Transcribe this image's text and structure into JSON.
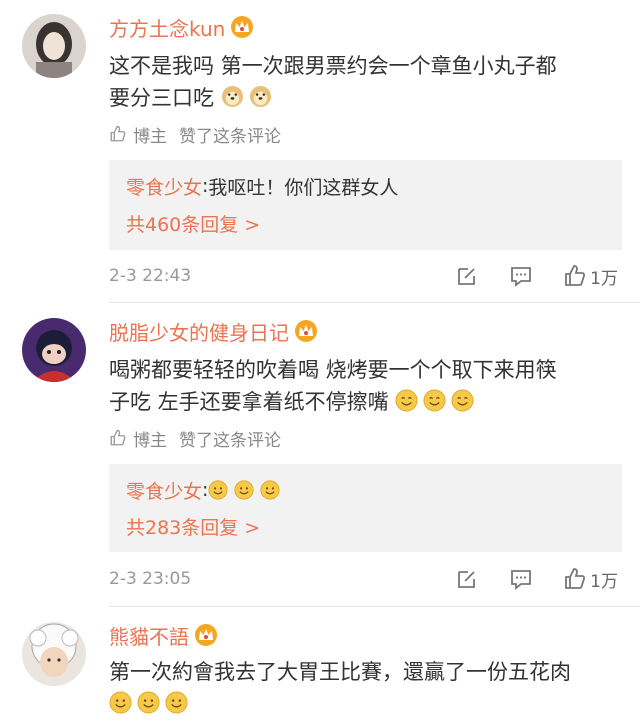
{
  "colors": {
    "username": "#eb7350",
    "reply_box": "#f2f2f2",
    "crown": "#f5a623"
  },
  "comments": [
    {
      "username": "方方土念kun",
      "text_lines": [
        "这不是我吗 第一次跟男票约会一个章鱼小丸子都",
        "要分三口吃"
      ],
      "text_emoji": [
        "doge-emoji",
        "doge-emoji"
      ],
      "like_label": "博主",
      "like_suffix": "赞了这条评论",
      "reply": {
        "name": "零食少女",
        "colon": ": ",
        "text": "我呕吐！你们这群女人",
        "count": "共460条回复 >"
      },
      "date": "2-3 22:43",
      "likes": "1万"
    },
    {
      "username": "脱脂少女的健身日记",
      "text_lines": [
        "喝粥都要轻轻的吹着喝 烧烤要一个个取下来用筷",
        "子吃 左手还要拿着纸不停擦嘴"
      ],
      "text_emoji": [
        "smile-emoji",
        "smile-emoji",
        "smile-emoji"
      ],
      "like_label": "博主",
      "like_suffix": "赞了这条评论",
      "reply": {
        "name": "零食少女",
        "colon": ": ",
        "text": "",
        "count": "共283条回复 >"
      },
      "reply_emoji": [
        "smile-emoji",
        "smile-emoji",
        "smile-emoji"
      ],
      "date": "2-3 23:05",
      "likes": "1万"
    },
    {
      "username": "熊貓不語",
      "text_lines": [
        "第一次約會我去了大胃王比賽，還贏了一份五花肉"
      ],
      "text_emoji": [
        "smile-emoji",
        "smile-emoji",
        "smile-emoji"
      ]
    }
  ]
}
